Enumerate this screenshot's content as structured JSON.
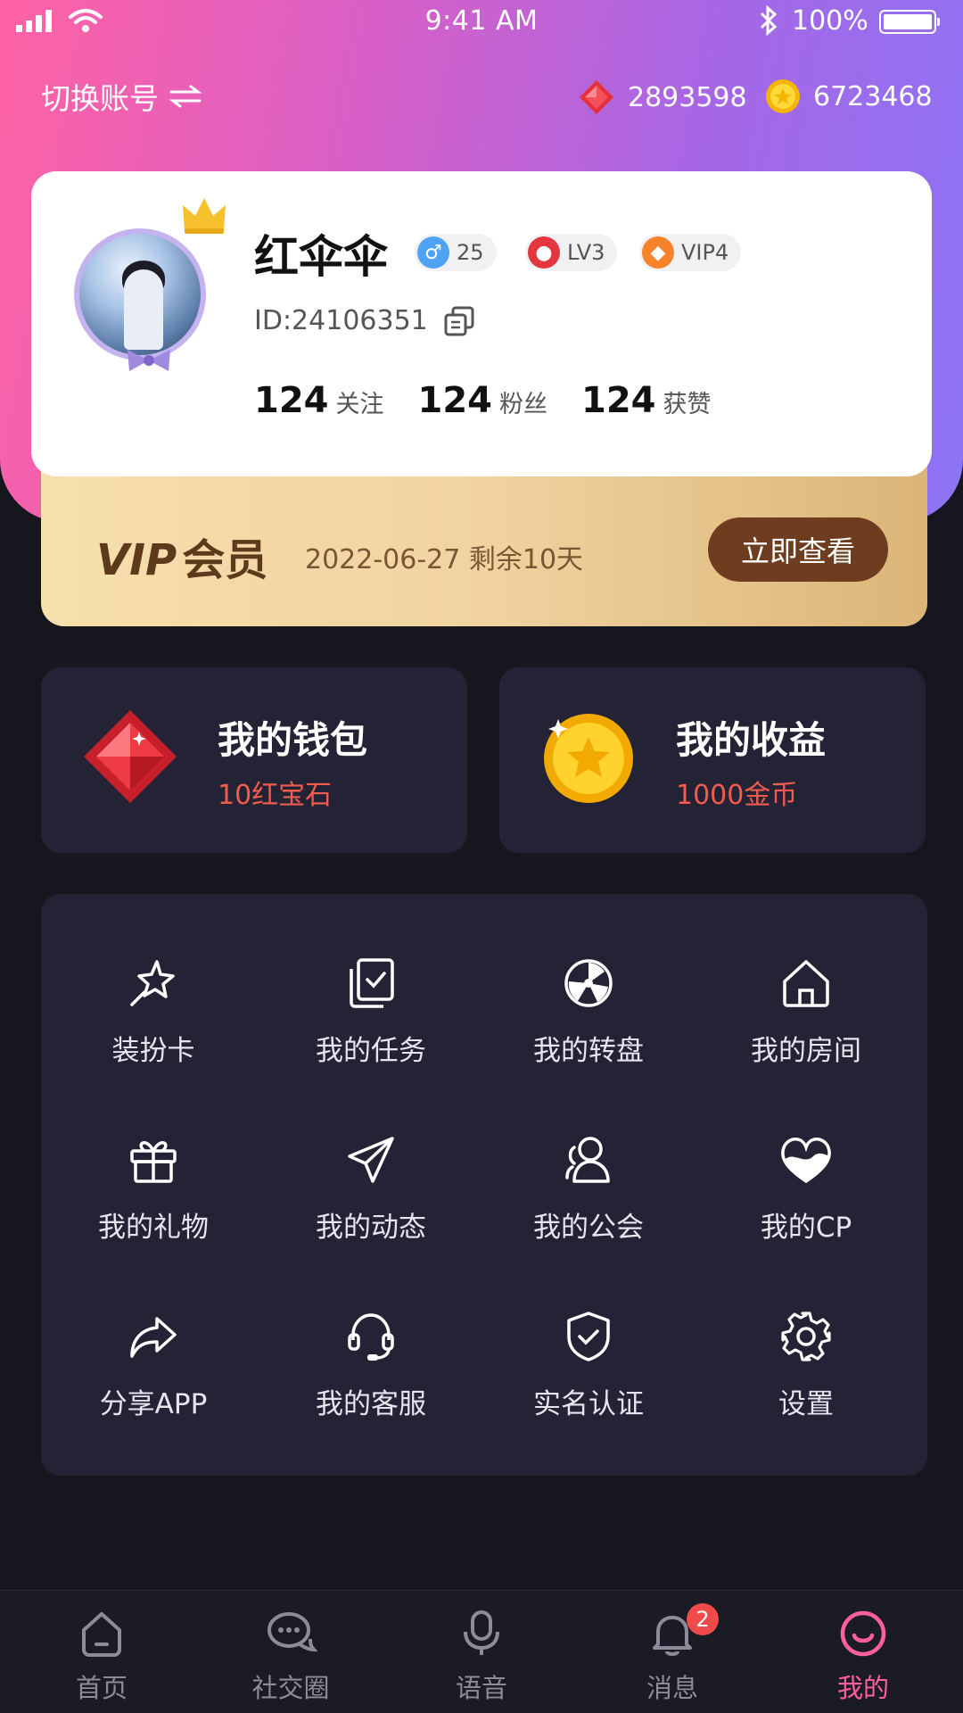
{
  "status_bar": {
    "time": "9:41 AM",
    "battery": "100%"
  },
  "header": {
    "switch_account": "切换账号",
    "gems": "2893598",
    "coins": "6723468"
  },
  "profile": {
    "nickname": "红伞伞",
    "age": "25",
    "level": "LV3",
    "vip": "VIP4",
    "id": "ID:24106351",
    "stats": [
      {
        "num": "124",
        "label": "关注"
      },
      {
        "num": "124",
        "label": "粉丝"
      },
      {
        "num": "124",
        "label": "获赞"
      }
    ]
  },
  "vip_banner": {
    "vip": "VIP",
    "member": "会员",
    "date": "2022-06-27 剩余10天",
    "button": "立即查看"
  },
  "wallet": {
    "title": "我的钱包",
    "sub": "10红宝石"
  },
  "earnings": {
    "title": "我的收益",
    "sub": "1000金币"
  },
  "menu": [
    {
      "label": "装扮卡",
      "icon": "star-wand-icon"
    },
    {
      "label": "我的任务",
      "icon": "task-list-icon"
    },
    {
      "label": "我的转盘",
      "icon": "wheel-icon"
    },
    {
      "label": "我的房间",
      "icon": "home-icon"
    },
    {
      "label": "我的礼物",
      "icon": "gift-icon"
    },
    {
      "label": "我的动态",
      "icon": "paper-plane-icon"
    },
    {
      "label": "我的公会",
      "icon": "users-icon"
    },
    {
      "label": "我的CP",
      "icon": "heart-icon"
    },
    {
      "label": "分享APP",
      "icon": "share-icon"
    },
    {
      "label": "我的客服",
      "icon": "headset-icon"
    },
    {
      "label": "实名认证",
      "icon": "shield-check-icon"
    },
    {
      "label": "设置",
      "icon": "gear-icon"
    }
  ],
  "tabs": [
    {
      "label": "首页",
      "icon": "home-tab-icon"
    },
    {
      "label": "社交圈",
      "icon": "chat-icon"
    },
    {
      "label": "语音",
      "icon": "mic-icon"
    },
    {
      "label": "消息",
      "icon": "bell-icon",
      "badge": "2"
    },
    {
      "label": "我的",
      "icon": "profile-tab-icon"
    }
  ],
  "colors": {
    "accent": "#ff5fa0",
    "gold": "#6e3d1f",
    "red_text": "#f25b4d"
  }
}
